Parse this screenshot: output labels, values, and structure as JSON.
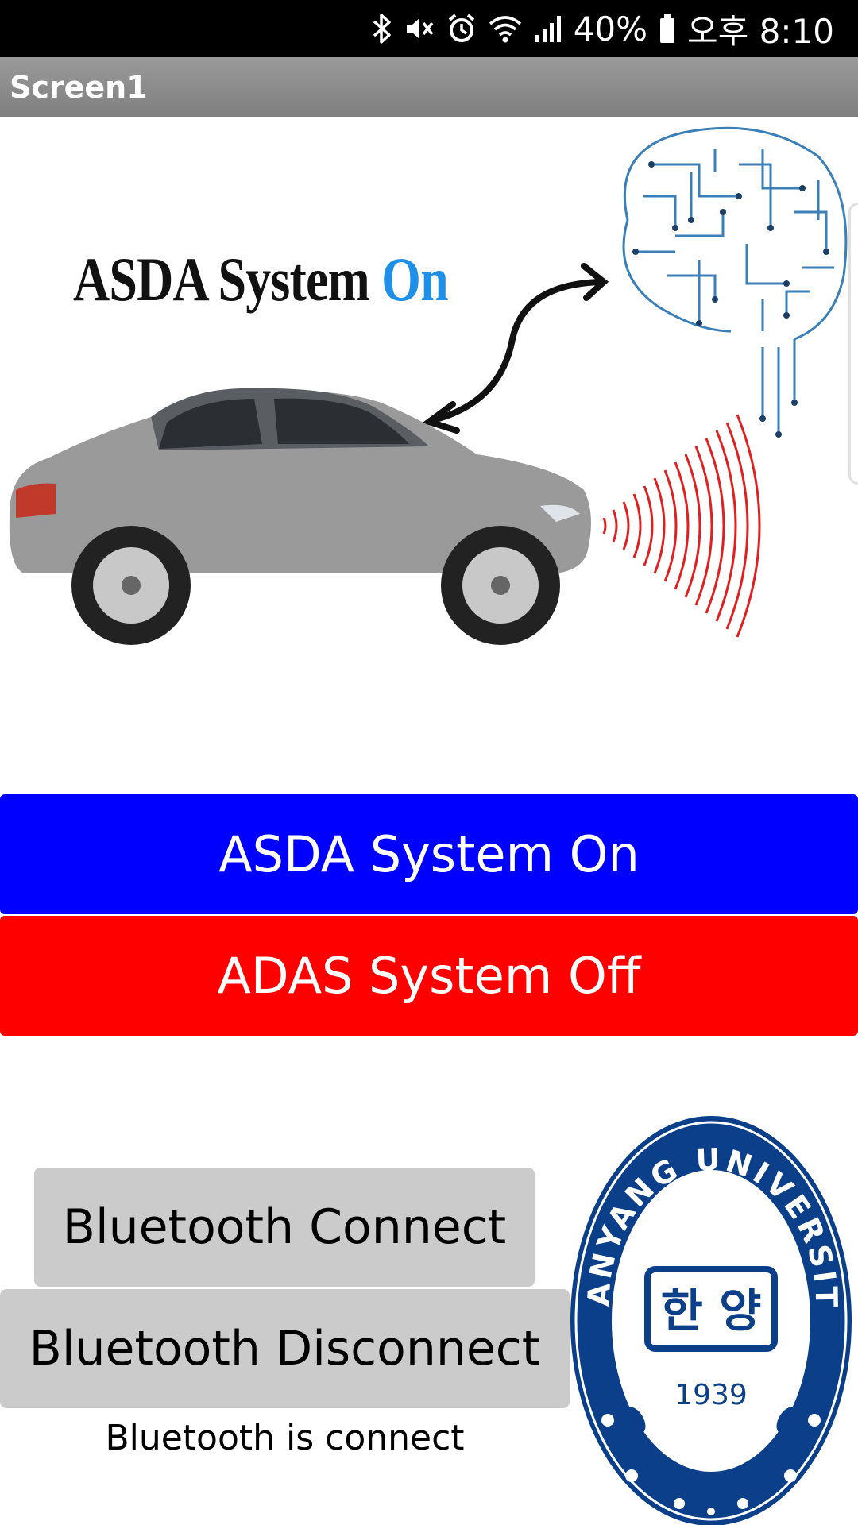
{
  "status_bar": {
    "icons": [
      "bluetooth-icon",
      "mute-icon",
      "alarm-icon",
      "wifi-icon",
      "signal-icon",
      "battery-icon"
    ],
    "battery": "40%",
    "time": "오후 8:10"
  },
  "title_bar": {
    "title": "Screen1"
  },
  "hero": {
    "title_main": "ASDA System ",
    "title_accent": "On",
    "accent_color": "#1e90e8",
    "car_color": "#9a9a9a",
    "radar_color": "#e02020",
    "brain_color": "#3a7fb8"
  },
  "buttons": {
    "system_on": "ASDA System On",
    "system_on_color": "#0000ff",
    "system_off": "ADAS System Off",
    "system_off_color": "#ff0000",
    "bt_connect": "Bluetooth Connect",
    "bt_disconnect": "Bluetooth Disconnect"
  },
  "status_label": "Bluetooth is connect",
  "seal": {
    "university": "HANYANG UNIVERSITY",
    "hangul": "한 양",
    "year": "1939",
    "color": "#0b3f8a"
  }
}
